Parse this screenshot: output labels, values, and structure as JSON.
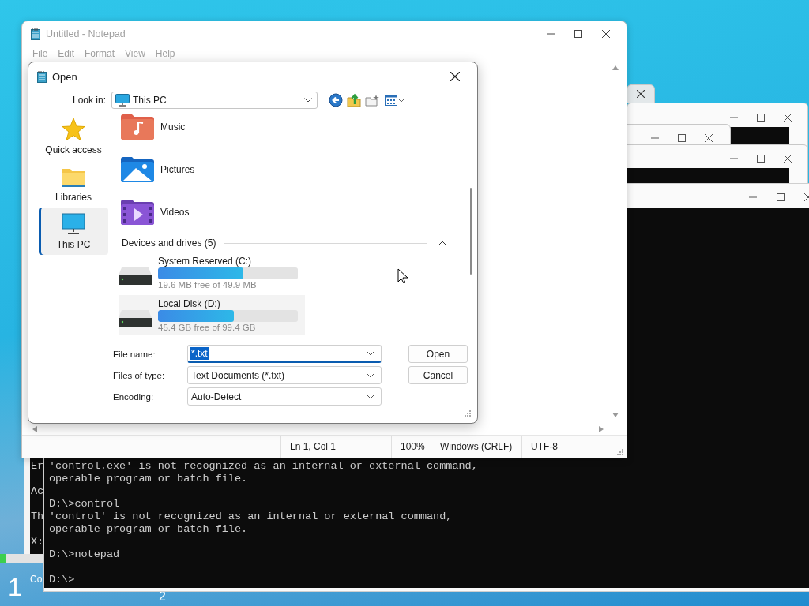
{
  "notepad": {
    "title": "Untitled - Notepad",
    "active": false,
    "menu": [
      "File",
      "Edit",
      "Format",
      "View",
      "Help"
    ],
    "status_bar": [
      "Ln 1, Col 1",
      "100%",
      "Windows (CRLF)",
      "UTF-8"
    ]
  },
  "open_dialog": {
    "title": "Open",
    "look_in": {
      "label": "Look in:",
      "value": "This PC"
    },
    "places": [
      {
        "label": "Quick access",
        "kind": "star",
        "selected": false
      },
      {
        "label": "Libraries",
        "kind": "folder",
        "selected": false
      },
      {
        "label": "This PC",
        "kind": "monitor",
        "selected": true
      }
    ],
    "folders": [
      {
        "name": "Music",
        "kind": "music"
      },
      {
        "name": "Pictures",
        "kind": "pictures"
      },
      {
        "name": "Videos",
        "kind": "videos"
      }
    ],
    "group": {
      "title": "Devices and drives (5)",
      "expanded": true
    },
    "drives": [
      {
        "name": "System Reserved (C:)",
        "level": 0.61,
        "free": "19.6 MB free of 49.9 MB",
        "selected": false
      },
      {
        "name": "Local Disk (D:)",
        "level": 0.54,
        "free": "45.4 GB free of 99.4 GB",
        "selected": true
      }
    ],
    "fields": [
      {
        "label": "File name:",
        "value": "*.txt",
        "highlighted": true
      },
      {
        "label": "Files of type:",
        "value": "Text Documents (*.txt)",
        "highlighted": false
      },
      {
        "label": "Encoding:",
        "value": "Auto-Detect",
        "highlighted": false
      }
    ],
    "buttons": [
      "Open",
      "Cancel"
    ]
  },
  "console": {
    "blocks": [
      [
        "'control.exe' is not recognized as an internal or external command,",
        "operable program or batch file."
      ],
      [
        "D:\\>control",
        "'control' is not recognized as an internal or external command,",
        "operable program or batch file."
      ],
      [
        "D:\\>notepad"
      ],
      [
        "D:\\>"
      ]
    ]
  },
  "back_console": {
    "lines": [
      "Er",
      "Ac",
      "Th",
      "X:"
    ]
  },
  "taskbar": {
    "number": "1",
    "label": "Col",
    "second_number": "2"
  }
}
